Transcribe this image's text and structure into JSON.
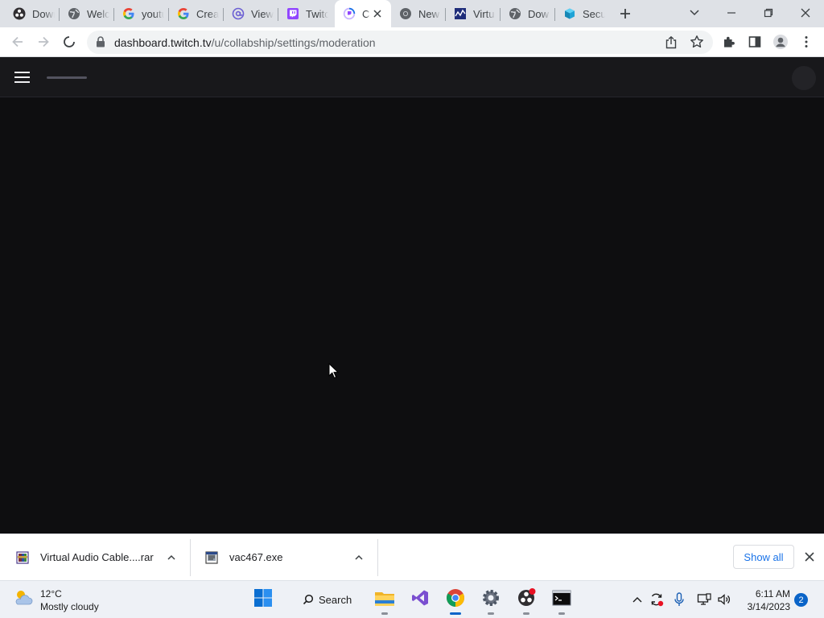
{
  "browser": {
    "tabs": [
      {
        "title": "Down",
        "icon": "obs-icon"
      },
      {
        "title": "Welc",
        "icon": "globe-icon"
      },
      {
        "title": "youtu",
        "icon": "google-icon"
      },
      {
        "title": "Creat",
        "icon": "google-icon"
      },
      {
        "title": "View",
        "icon": "at-sign-icon"
      },
      {
        "title": "Twitc",
        "icon": "twitch-icon"
      },
      {
        "title": "C",
        "icon": "twitch-loading-icon",
        "active": true
      },
      {
        "title": "New",
        "icon": "chrome-icon"
      },
      {
        "title": "Virtu",
        "icon": "vac-icon"
      },
      {
        "title": "Dow",
        "icon": "globe-icon"
      },
      {
        "title": "Secur",
        "icon": "cube-icon"
      }
    ],
    "url": {
      "domain": "dashboard.twitch.tv",
      "path": "/u/collabship/settings/moderation"
    }
  },
  "downloads": {
    "items": [
      {
        "name": "Virtual Audio Cable....rar",
        "icon": "winrar-icon"
      },
      {
        "name": "vac467.exe",
        "icon": "exe-icon"
      }
    ],
    "show_all": "Show all"
  },
  "taskbar": {
    "weather": {
      "temp": "12°C",
      "condition": "Mostly cloudy"
    },
    "search_label": "Search",
    "apps": [
      "start-icon",
      "file-explorer-icon",
      "visual-studio-icon",
      "chrome-icon",
      "settings-icon",
      "obs-icon",
      "terminal-icon"
    ],
    "clock": {
      "time": "6:11 AM",
      "date": "3/14/2023"
    },
    "notification_count": "2"
  },
  "colors": {
    "twitch_bg": "#0e0e10",
    "twitch_nav": "#18181b",
    "chrome_accent": "#1a73e8",
    "taskbar_accent": "#0a64c8"
  }
}
